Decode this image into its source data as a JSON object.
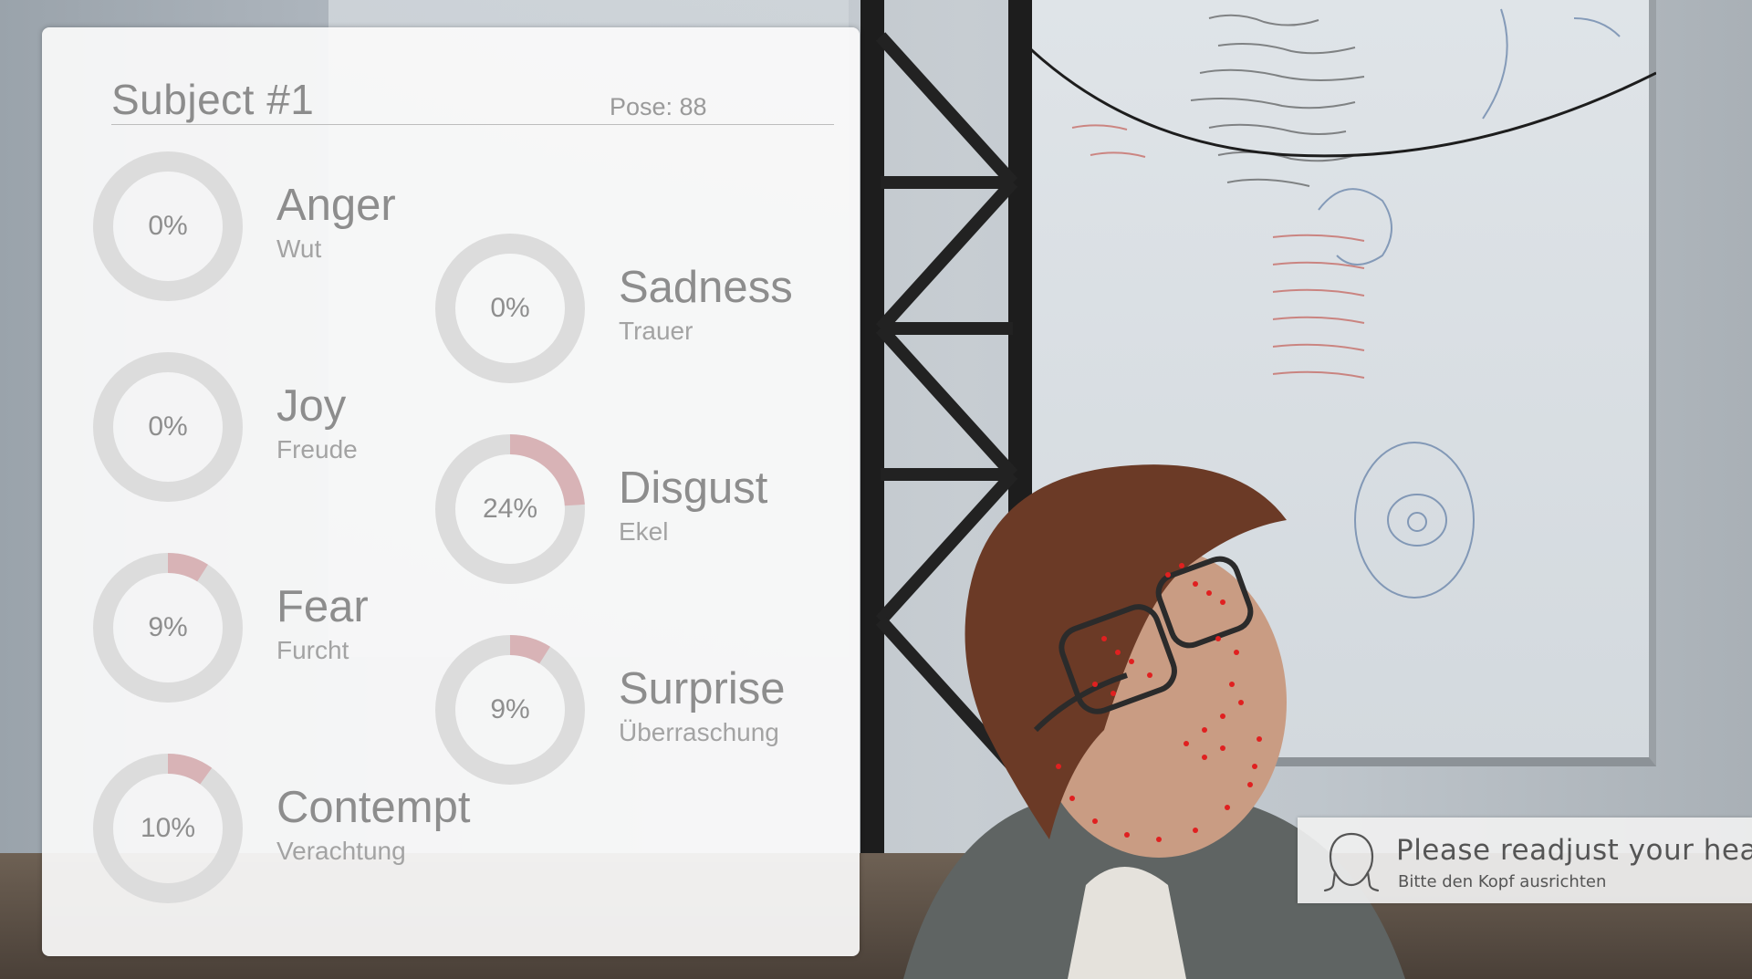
{
  "subject": {
    "title": "Subject #1",
    "pose_label": "Pose: 88"
  },
  "emotions": [
    {
      "id": "anger",
      "name": "Anger",
      "name_de": "Wut",
      "percent_label": "0%",
      "fraction": 0.0
    },
    {
      "id": "joy",
      "name": "Joy",
      "name_de": "Freude",
      "percent_label": "0%",
      "fraction": 0.0
    },
    {
      "id": "fear",
      "name": "Fear",
      "name_de": "Furcht",
      "percent_label": "9%",
      "fraction": 0.09
    },
    {
      "id": "contempt",
      "name": "Contempt",
      "name_de": "Verachtung",
      "percent_label": "10%",
      "fraction": 0.1
    },
    {
      "id": "sadness",
      "name": "Sadness",
      "name_de": "Trauer",
      "percent_label": "0%",
      "fraction": 0.0
    },
    {
      "id": "disgust",
      "name": "Disgust",
      "name_de": "Ekel",
      "percent_label": "24%",
      "fraction": 0.24
    },
    {
      "id": "surprise",
      "name": "Surprise",
      "name_de": "Überraschung",
      "percent_label": "9%",
      "fraction": 0.09
    }
  ],
  "toast": {
    "title": "Please readjust your head",
    "subtitle": "Bitte den Kopf ausrichten",
    "icon": "head-outline-icon"
  },
  "colors": {
    "ring_track": "#dcdcdc",
    "ring_fill": "#d8b3b6"
  }
}
